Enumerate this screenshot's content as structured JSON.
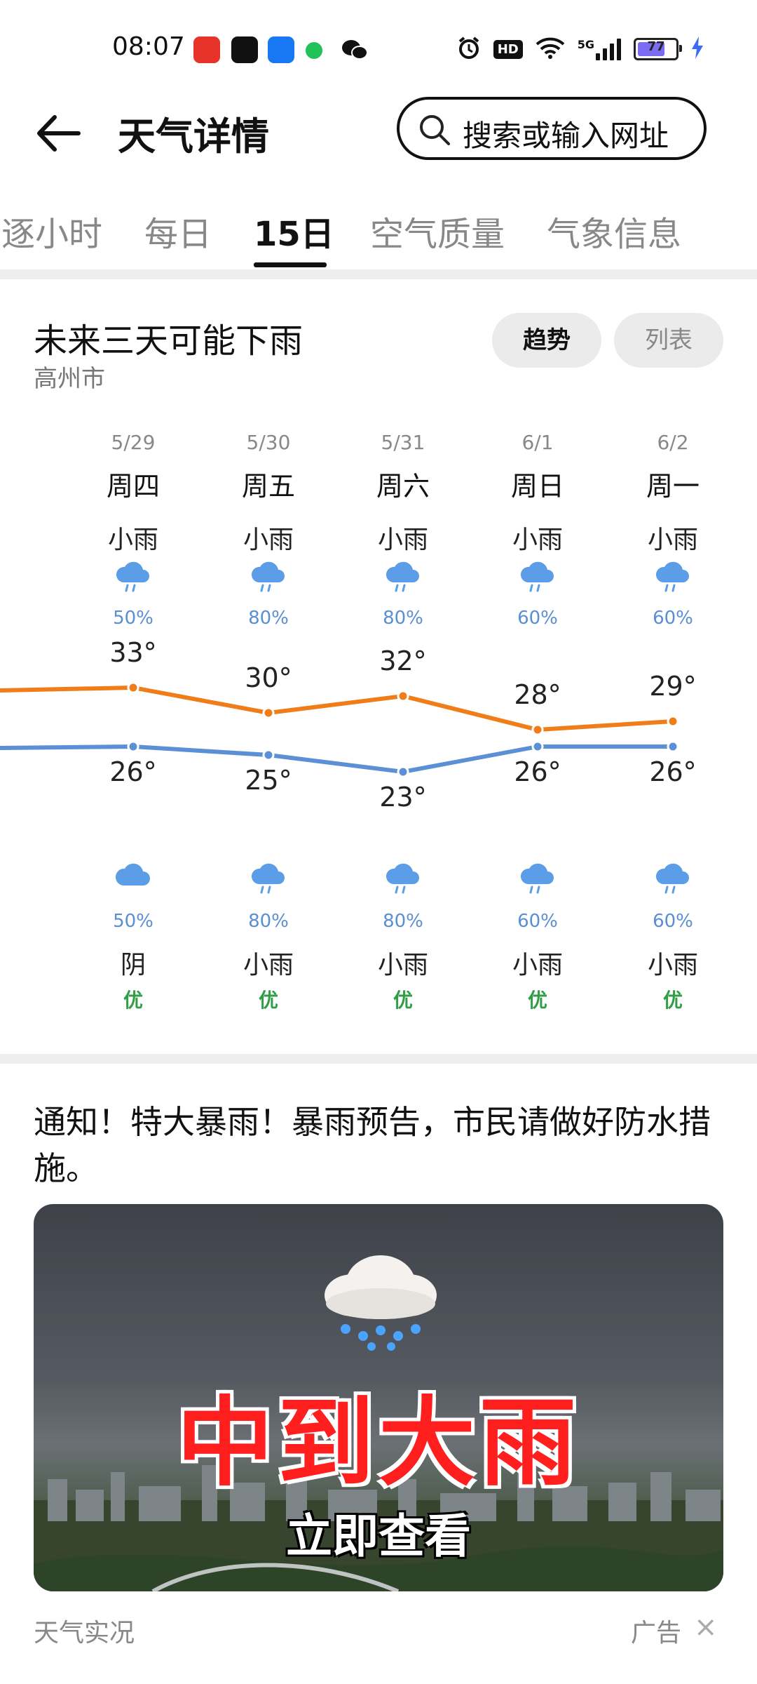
{
  "status_bar": {
    "time": "08:07",
    "app_icons": [
      "taobao-icon",
      "douyin-icon",
      "shield-app-icon",
      "message-app-icon",
      "wechat-icon"
    ],
    "right_icons": [
      "alarm-icon",
      "hd-icon",
      "wifi-icon",
      "5g-signal-icon",
      "battery-icon",
      "charging-icon"
    ],
    "hd": "HD",
    "network": "5G",
    "battery": "77",
    "battery_level": 0.77
  },
  "header": {
    "title": "天气详情",
    "search_placeholder": "搜索或输入网址"
  },
  "tabs": [
    {
      "label": "逐小时",
      "active": false
    },
    {
      "label": "每日",
      "active": false
    },
    {
      "label": "15日",
      "active": true
    },
    {
      "label": "空气质量",
      "active": false
    },
    {
      "label": "气象信息",
      "active": false
    }
  ],
  "forecast": {
    "title": "未来三天可能下雨",
    "city": "高州市",
    "view_toggle": [
      "趋势",
      "列表"
    ],
    "view_active": "趋势",
    "days": [
      {
        "date": "5/29",
        "weekday": "周四",
        "day_cond": "小雨",
        "day_pop": "50%",
        "high": "33°",
        "low": "26°",
        "night_pop": "50%",
        "night_cond": "阴",
        "aqi": "优"
      },
      {
        "date": "5/30",
        "weekday": "周五",
        "day_cond": "小雨",
        "day_pop": "80%",
        "high": "30°",
        "low": "25°",
        "night_pop": "80%",
        "night_cond": "小雨",
        "aqi": "优"
      },
      {
        "date": "5/31",
        "weekday": "周六",
        "day_cond": "小雨",
        "day_pop": "80%",
        "high": "32°",
        "low": "23°",
        "night_pop": "80%",
        "night_cond": "小雨",
        "aqi": "优"
      },
      {
        "date": "6/1",
        "weekday": "周日",
        "day_cond": "小雨",
        "day_pop": "60%",
        "high": "28°",
        "low": "26°",
        "night_pop": "60%",
        "night_cond": "小雨",
        "aqi": "优"
      },
      {
        "date": "6/2",
        "weekday": "周一",
        "day_cond": "小雨",
        "day_pop": "60%",
        "high": "29°",
        "low": "26°",
        "night_pop": "60%",
        "night_cond": "小雨",
        "aqi": "优"
      }
    ],
    "high_color": "#f07d18",
    "low_color": "#5b8fd6"
  },
  "notice": {
    "text": "通知！特大暴雨！暴雨预告，市民请做好防水措施。",
    "banner_headline": "中到大雨",
    "banner_cta": "立即查看"
  },
  "footer": {
    "left": "天气实况",
    "ad": "广告",
    "close": "×"
  }
}
